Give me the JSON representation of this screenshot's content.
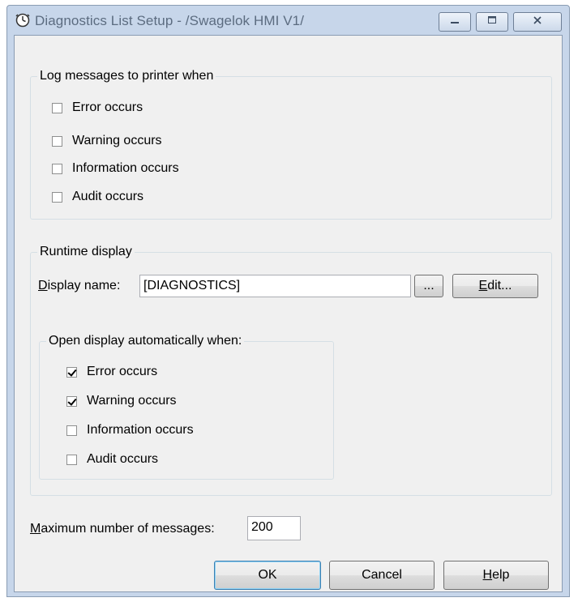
{
  "window": {
    "title": "Diagnostics List Setup - /Swagelok HMI V1/",
    "accent_color": "#c7d6ea",
    "client_bg": "#f0f0f0"
  },
  "titlebar_buttons": {
    "minimize_icon": "minimize-icon",
    "maximize_icon": "maximize-icon",
    "close_icon": "close-icon"
  },
  "log_group": {
    "legend": "Log messages to printer when",
    "items": [
      {
        "label": "Error occurs",
        "checked": false
      },
      {
        "label": "Warning occurs",
        "checked": false
      },
      {
        "label": "Information occurs",
        "checked": false
      },
      {
        "label": "Audit occurs",
        "checked": false
      }
    ]
  },
  "runtime_group": {
    "legend": "Runtime display",
    "display_name_label_prefix": "D",
    "display_name_label_rest": "isplay name:",
    "display_name_value": "[DIAGNOSTICS]",
    "browse_label": "...",
    "edit_label_prefix": "E",
    "edit_label_rest": "dit..."
  },
  "open_group": {
    "legend": "Open display automatically when:",
    "items": [
      {
        "label": "Error occurs",
        "checked": true
      },
      {
        "label": "Warning occurs",
        "checked": true
      },
      {
        "label": "Information occurs",
        "checked": false
      },
      {
        "label": "Audit occurs",
        "checked": false
      }
    ]
  },
  "max_messages": {
    "label_prefix": "M",
    "label_rest": "aximum number of messages:",
    "value": "200"
  },
  "buttons": {
    "ok": "OK",
    "cancel": "Cancel",
    "help_prefix": "H",
    "help_rest": "elp"
  }
}
